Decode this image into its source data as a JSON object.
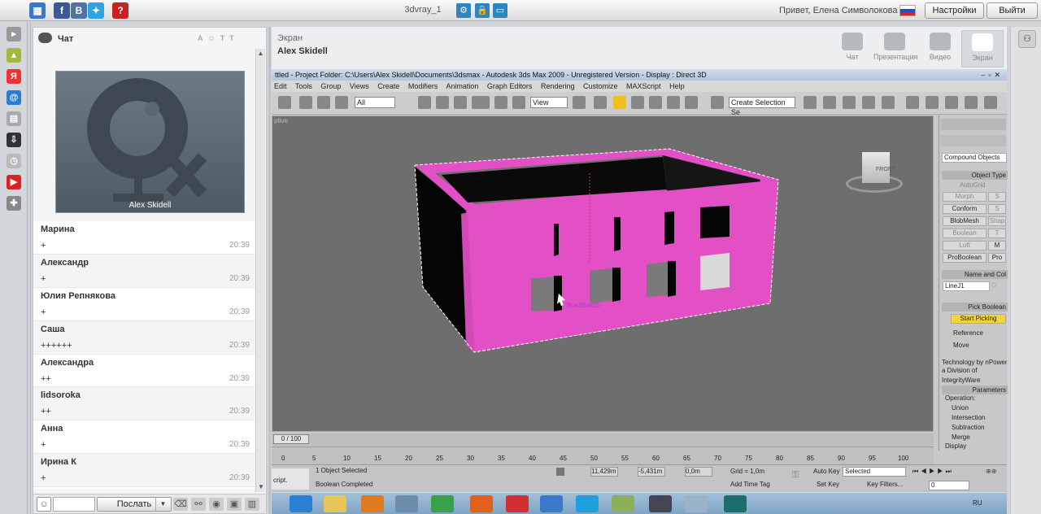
{
  "topbar": {
    "room_name": "3dvray_1",
    "greeting": "Привет, Елена Символокова",
    "settings_label": "Настройки",
    "logout_label": "Выйти",
    "social_labels": [
      "f",
      "B"
    ],
    "help_label": "?"
  },
  "chat": {
    "title": "Чат",
    "video_caption": "Alex Skidell",
    "send_label": "Послать",
    "messages": [
      {
        "name": "Марина",
        "text": "+",
        "time": "20:39"
      },
      {
        "name": "Александр",
        "text": "+",
        "time": "20:39"
      },
      {
        "name": "Юлия Репнякова",
        "text": "+",
        "time": "20:39"
      },
      {
        "name": "Саша",
        "text": "++++++",
        "time": "20:39"
      },
      {
        "name": "Александра",
        "text": "++",
        "time": "20:39"
      },
      {
        "name": "lidsoroka",
        "text": "++",
        "time": "20:39"
      },
      {
        "name": "Анна",
        "text": "+",
        "time": "20:39"
      },
      {
        "name": "Ирина К",
        "text": "+",
        "time": "20:39"
      }
    ]
  },
  "screen": {
    "title": "Экран",
    "presenter": "Alex Skidell",
    "modes": [
      "Чат",
      "Презентация",
      "Видео",
      "Экран"
    ],
    "active_mode": "Экран"
  },
  "max": {
    "window_title": "ttled   - Project Folder: C:\\Users\\Alex Skidell\\Documents\\3dsmax   - Autodesk 3ds Max  2009   - Unregistered Version   - Display : Direct 3D",
    "menu": [
      "Edit",
      "Tools",
      "Group",
      "Views",
      "Create",
      "Modifiers",
      "Animation",
      "Graph Editors",
      "Rendering",
      "Customize",
      "MAXScript",
      "Help"
    ],
    "toolbar": {
      "filter": "All",
      "refcoord": "View",
      "selset": "Create Selection Se"
    },
    "viewport_label": "ptive",
    "viewcube_label": "FRONT",
    "object_label": "Box3Box01",
    "cmd": {
      "category": "Compound Objects",
      "object_type_header": "Object Type",
      "autogrid": "AutoGrid",
      "buttons": [
        "Morph",
        "S",
        "Conform",
        "S",
        "BlobMesh",
        "Shap",
        "Boolean",
        "T",
        "Loft",
        "M",
        "ProBoolean",
        "Pro"
      ],
      "name_header": "Name and Col",
      "name_value": "LineJ1",
      "pick_header": "Pick Boolean",
      "start_picking": "Start Picking",
      "reference": "Reference",
      "move": "Move",
      "technology": "Technology by nPower",
      "technology2": "a Division of IntegrityWare",
      "params_header": "Parameters",
      "operation": "Operation:",
      "ops": [
        "Union",
        "Intersection",
        "Subtraction",
        "Merge"
      ],
      "display": "Display"
    },
    "timeline": {
      "frame": "0 / 100",
      "ticks": [
        "0",
        "5",
        "10",
        "15",
        "20",
        "25",
        "30",
        "35",
        "40",
        "45",
        "50",
        "55",
        "60",
        "65",
        "70",
        "75",
        "80",
        "85",
        "90",
        "95",
        "100"
      ]
    },
    "status": {
      "selected": "1 Object Selected",
      "completed": "Boolean Completed",
      "x": "11,429m",
      "y": "-5,431m",
      "z": "0,0m",
      "grid": "Grid = 1,0m",
      "autokey": "Auto Key",
      "setkey": "Set Key",
      "selected_dd": "Selected",
      "keyfilters": "Key Filters...",
      "addtimetag": "Add Time Tag",
      "frame": "0",
      "script": "cript."
    },
    "taskbar_lang": "RU"
  },
  "colors": {
    "box_pink": "#e34fc4",
    "box_dark": "#000000",
    "viewport_bg": "#6e6e6e",
    "accent_blue": "#2e86c1"
  }
}
